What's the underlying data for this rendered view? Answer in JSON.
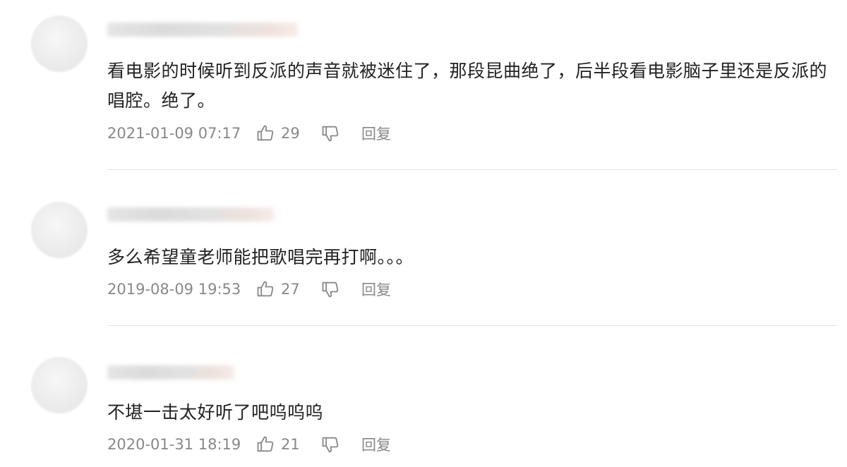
{
  "comments": [
    {
      "text": "看电影的时候听到反派的声音就被迷住了，那段昆曲绝了，后半段看电影脑子里还是反派的唱腔。绝了。",
      "time": "2021-01-09 07:17",
      "likes": "29",
      "reply_label": "回复"
    },
    {
      "text": "多么希望童老师能把歌唱完再打啊。。。",
      "time": "2019-08-09 19:53",
      "likes": "27",
      "reply_label": "回复"
    },
    {
      "text": "不堪一击太好听了吧呜呜呜",
      "time": "2020-01-31 18:19",
      "likes": "21",
      "reply_label": "回复"
    }
  ],
  "icons": {
    "like": "thumbs-up-icon",
    "dislike": "thumbs-down-icon"
  },
  "colors": {
    "text": "#222222",
    "meta": "#888888",
    "divider": "#e3e3e3"
  }
}
